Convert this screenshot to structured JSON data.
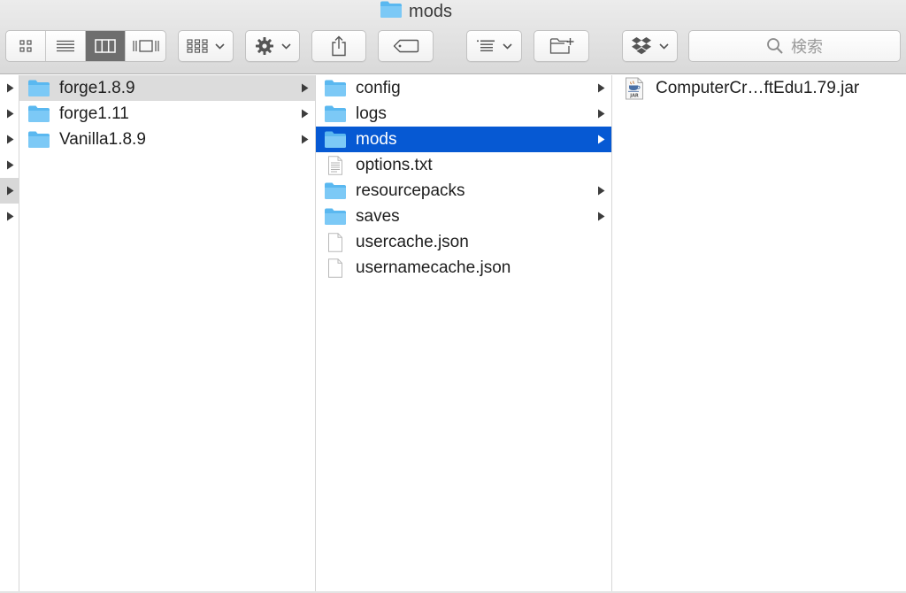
{
  "window": {
    "title": "mods"
  },
  "toolbar": {
    "search_placeholder": "検索"
  },
  "columns": {
    "col1": [
      {
        "label": "forge1.8.9",
        "type": "folder",
        "state": "path-selected",
        "has_children": true
      },
      {
        "label": "forge1.11",
        "type": "folder",
        "state": "",
        "has_children": true
      },
      {
        "label": "Vanilla1.8.9",
        "type": "folder",
        "state": "",
        "has_children": true
      }
    ],
    "col2": [
      {
        "label": "config",
        "type": "folder",
        "state": "",
        "has_children": true
      },
      {
        "label": "logs",
        "type": "folder",
        "state": "",
        "has_children": true
      },
      {
        "label": "mods",
        "type": "folder",
        "state": "selected",
        "has_children": true
      },
      {
        "label": "options.txt",
        "type": "text-file",
        "state": "",
        "has_children": false
      },
      {
        "label": "resourcepacks",
        "type": "folder",
        "state": "",
        "has_children": true
      },
      {
        "label": "saves",
        "type": "folder",
        "state": "",
        "has_children": true
      },
      {
        "label": "usercache.json",
        "type": "file",
        "state": "",
        "has_children": false
      },
      {
        "label": "usernamecache.json",
        "type": "file",
        "state": "",
        "has_children": false
      }
    ],
    "col3": [
      {
        "label": "ComputerCr…ftEdu1.79.jar",
        "type": "jar-file",
        "icon_caption": "JAR"
      }
    ]
  },
  "colors": {
    "selection_blue": "#0659d3",
    "path_grey": "#dcdcdc",
    "folder_blue": "#5ab8f0",
    "active_view_button": "#6e6e6e"
  }
}
